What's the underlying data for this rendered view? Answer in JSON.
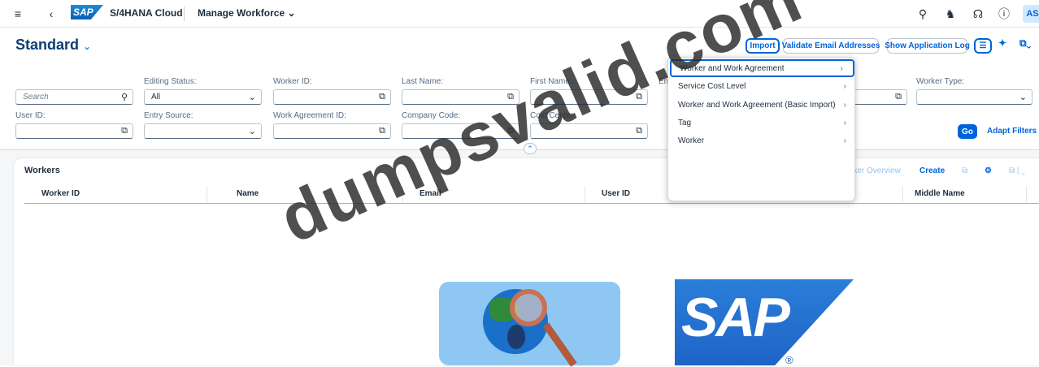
{
  "shell": {
    "logo": "SAP",
    "product": "S/4HANA Cloud",
    "app_title": "Manage Workforce",
    "avatar_initials": "AS"
  },
  "header": {
    "variant": "Standard",
    "buttons": {
      "import": "Import",
      "validate": "Validate Email Addresses",
      "show_log": "Show Application Log"
    }
  },
  "filters": {
    "search_placeholder": "Search",
    "editing_status": {
      "label": "Editing Status:",
      "value": "All"
    },
    "worker_id": {
      "label": "Worker ID:",
      "value": ""
    },
    "last_name": {
      "label": "Last Name:",
      "value": ""
    },
    "first_name": {
      "label": "First Name:",
      "value": ""
    },
    "email_label_partial": "Em",
    "worker_type": {
      "label": "Worker Type:",
      "value": ""
    },
    "user_id": {
      "label": "User ID:",
      "value": ""
    },
    "entry_source": {
      "label": "Entry Source:",
      "value": ""
    },
    "work_agreement_id": {
      "label": "Work Agreement ID:",
      "value": ""
    },
    "company_code": {
      "label": "Company Code:",
      "value": ""
    },
    "cost_center": {
      "label": "Cost Center:",
      "value": ""
    },
    "go": "Go",
    "adapt": "Adapt Filters"
  },
  "table": {
    "title": "Workers",
    "toolbar": {
      "overview": "rker Overview",
      "create": "Create"
    },
    "columns": [
      "Worker ID",
      "Name",
      "Email",
      "User ID",
      "Middle Name"
    ]
  },
  "import_menu": {
    "items": [
      "Worker and Work Agreement",
      "Service Cost Level",
      "Worker and Work Agreement (Basic Import)",
      "Tag",
      "Worker"
    ]
  },
  "illustration": {
    "logo_text": "SAP",
    "registered": "®"
  },
  "watermark": "dumpsvalid.com"
}
